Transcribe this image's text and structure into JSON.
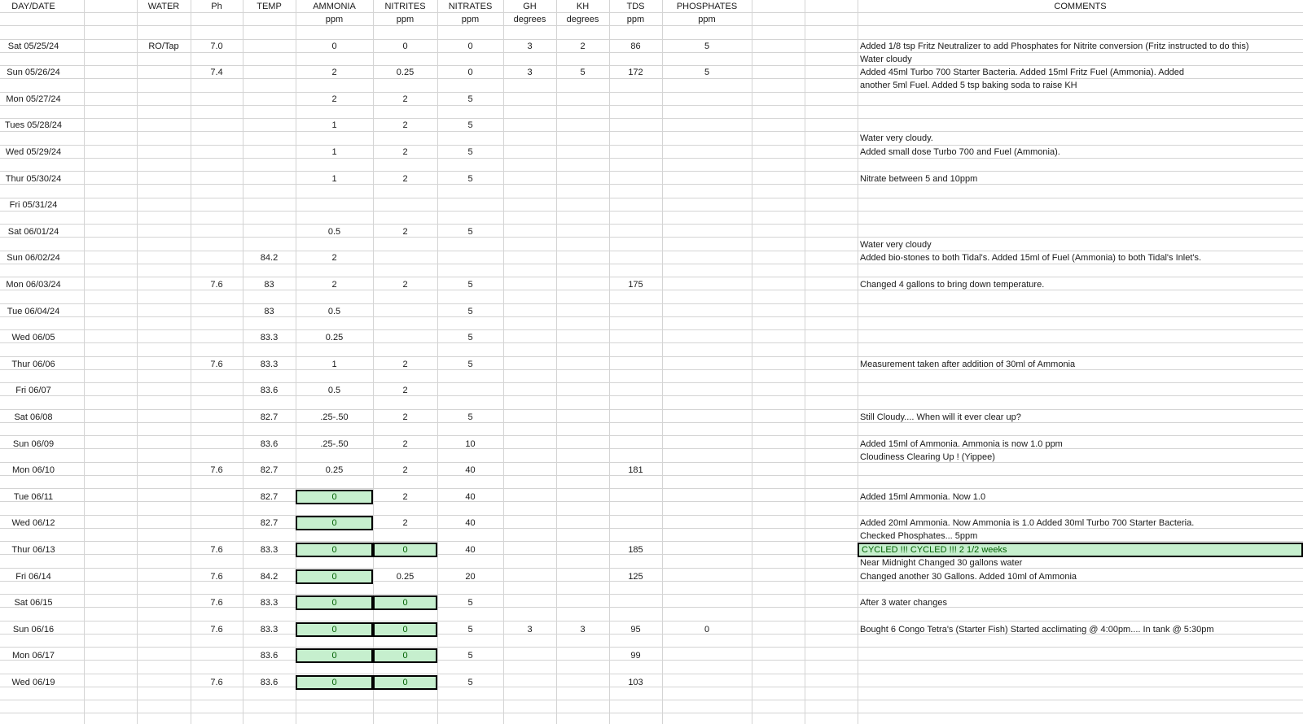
{
  "headers": {
    "date": "DAY/DATE",
    "water": "WATER",
    "ph": "Ph",
    "temp": "TEMP",
    "ammonia": "AMMONIA",
    "nitrites": "NITRITES",
    "nitrates": "NITRATES",
    "gh": "GH",
    "kh": "KH",
    "tds": "TDS",
    "phosphates": "PHOSPHATES",
    "comments": "COMMENTS"
  },
  "units": {
    "ammonia": "ppm",
    "nitrites": "ppm",
    "nitrates": "ppm",
    "gh": "degrees",
    "kh": "degrees",
    "tds": "ppm",
    "phosphates": "ppm"
  },
  "rows": [
    {
      "date": "Sat 05/25/24",
      "water": "RO/Tap",
      "ph": "7.0",
      "temp": "",
      "ammonia": "0",
      "nitrites": "0",
      "nitrates": "0",
      "gh": "3",
      "kh": "2",
      "tds": "86",
      "phosphates": "5",
      "comment": "Added 1/8 tsp Fritz Neutralizer to add Phosphates for Nitrite conversion  (Fritz instructed to do this)",
      "comment2": "Water cloudy"
    },
    {
      "date": "Sun 05/26/24",
      "water": "",
      "ph": "7.4",
      "temp": "",
      "ammonia": "2",
      "nitrites": "0.25",
      "nitrates": "0",
      "gh": "3",
      "kh": "5",
      "tds": "172",
      "phosphates": "5",
      "comment": "Added 45ml Turbo 700 Starter Bacteria. Added 15ml Fritz Fuel (Ammonia). Added",
      "comment2": "another 5ml Fuel. Added 5 tsp baking soda to raise KH"
    },
    {
      "date": "Mon 05/27/24",
      "water": "",
      "ph": "",
      "temp": "",
      "ammonia": "2",
      "nitrites": "2",
      "nitrates": "5",
      "gh": "",
      "kh": "",
      "tds": "",
      "phosphates": "",
      "comment": "",
      "comment2": ""
    },
    {
      "date": "Tues 05/28/24",
      "water": "",
      "ph": "",
      "temp": "",
      "ammonia": "1",
      "nitrites": "2",
      "nitrates": "5",
      "gh": "",
      "kh": "",
      "tds": "",
      "phosphates": "",
      "comment": "",
      "comment2": "Water very cloudy."
    },
    {
      "date": "Wed 05/29/24",
      "water": "",
      "ph": "",
      "temp": "",
      "ammonia": "1",
      "nitrites": "2",
      "nitrates": "5",
      "gh": "",
      "kh": "",
      "tds": "",
      "phosphates": "",
      "comment": "Added small dose Turbo 700 and Fuel (Ammonia).",
      "comment2": ""
    },
    {
      "date": "Thur 05/30/24",
      "water": "",
      "ph": "",
      "temp": "",
      "ammonia": "1",
      "nitrites": "2",
      "nitrates": "5",
      "gh": "",
      "kh": "",
      "tds": "",
      "phosphates": "",
      "comment": "Nitrate between 5 and 10ppm",
      "comment2": ""
    },
    {
      "date": "Fri 05/31/24",
      "water": "",
      "ph": "",
      "temp": "",
      "ammonia": "",
      "nitrites": "",
      "nitrates": "",
      "gh": "",
      "kh": "",
      "tds": "",
      "phosphates": "",
      "comment": "",
      "comment2": ""
    },
    {
      "date": "Sat 06/01/24",
      "water": "",
      "ph": "",
      "temp": "",
      "ammonia": "0.5",
      "nitrites": "2",
      "nitrates": "5",
      "gh": "",
      "kh": "",
      "tds": "",
      "phosphates": "",
      "comment": "",
      "comment2": "Water very cloudy"
    },
    {
      "date": "Sun 06/02/24",
      "water": "",
      "ph": "",
      "temp": "84.2",
      "ammonia": "2",
      "nitrites": "",
      "nitrates": "",
      "gh": "",
      "kh": "",
      "tds": "",
      "phosphates": "",
      "comment": "Added bio-stones to both Tidal's. Added 15ml of Fuel (Ammonia) to both Tidal's Inlet's.",
      "comment2": ""
    },
    {
      "date": "Mon 06/03/24",
      "water": "",
      "ph": "7.6",
      "temp": "83",
      "ammonia": "2",
      "nitrites": "2",
      "nitrates": "5",
      "gh": "",
      "kh": "",
      "tds": "175",
      "phosphates": "",
      "comment": "Changed 4 gallons to bring down temperature.",
      "comment2": ""
    },
    {
      "date": "Tue 06/04/24",
      "water": "",
      "ph": "",
      "temp": "83",
      "ammonia": "0.5",
      "nitrites": "",
      "nitrates": "5",
      "gh": "",
      "kh": "",
      "tds": "",
      "phosphates": "",
      "comment": "",
      "comment2": ""
    },
    {
      "date": "Wed 06/05",
      "water": "",
      "ph": "",
      "temp": "83.3",
      "ammonia": "0.25",
      "nitrites": "",
      "nitrates": "5",
      "gh": "",
      "kh": "",
      "tds": "",
      "phosphates": "",
      "comment": "",
      "comment2": ""
    },
    {
      "date": "Thur 06/06",
      "water": "",
      "ph": "7.6",
      "temp": "83.3",
      "ammonia": "1",
      "nitrites": "2",
      "nitrates": "5",
      "gh": "",
      "kh": "",
      "tds": "",
      "phosphates": "",
      "comment": "Measurement taken after addition of 30ml of Ammonia",
      "comment2": ""
    },
    {
      "date": "Fri 06/07",
      "water": "",
      "ph": "",
      "temp": "83.6",
      "ammonia": "0.5",
      "nitrites": "2",
      "nitrates": "",
      "gh": "",
      "kh": "",
      "tds": "",
      "phosphates": "",
      "comment": "",
      "comment2": ""
    },
    {
      "date": "Sat 06/08",
      "water": "",
      "ph": "",
      "temp": "82.7",
      "ammonia": ".25-.50",
      "nitrites": "2",
      "nitrates": "5",
      "gh": "",
      "kh": "",
      "tds": "",
      "phosphates": "",
      "comment": "Still Cloudy.... When will it ever clear up?",
      "comment2": ""
    },
    {
      "date": "Sun 06/09",
      "water": "",
      "ph": "",
      "temp": "83.6",
      "ammonia": ".25-.50",
      "nitrites": "2",
      "nitrates": "10",
      "gh": "",
      "kh": "",
      "tds": "",
      "phosphates": "",
      "comment": "Added 15ml of Ammonia.  Ammonia is now 1.0 ppm",
      "comment2": "Cloudiness Clearing Up ! (Yippee)"
    },
    {
      "date": "Mon 06/10",
      "water": "",
      "ph": "7.6",
      "temp": "82.7",
      "ammonia": "0.25",
      "nitrites": "2",
      "nitrates": "40",
      "gh": "",
      "kh": "",
      "tds": "181",
      "phosphates": "",
      "comment": "",
      "comment2": ""
    },
    {
      "date": "Tue 06/11",
      "water": "",
      "ph": "",
      "temp": "82.7",
      "ammonia": "0",
      "nitrites": "2",
      "nitrates": "40",
      "gh": "",
      "kh": "",
      "tds": "",
      "phosphates": "",
      "comment": "Added 15ml Ammonia. Now 1.0",
      "comment2": ""
    },
    {
      "date": "Wed 06/12",
      "water": "",
      "ph": "",
      "temp": "82.7",
      "ammonia": "0",
      "nitrites": "2",
      "nitrates": "40",
      "gh": "",
      "kh": "",
      "tds": "",
      "phosphates": "",
      "comment": "Added 20ml Ammonia. Now Ammonia is 1.0  Added 30ml Turbo 700 Starter Bacteria.",
      "comment2": "Checked Phosphates... 5ppm"
    },
    {
      "date": "Thur 06/13",
      "water": "",
      "ph": "7.6",
      "temp": "83.3",
      "ammonia": "0",
      "nitrites": "0",
      "nitrates": "40",
      "gh": "",
      "kh": "",
      "tds": "185",
      "phosphates": "",
      "comment": "CYCLED !!! CYCLED !!!   2 1/2 weeks",
      "comment2": "Near Midnight Changed 30 gallons water"
    },
    {
      "date": "Fri 06/14",
      "water": "",
      "ph": "7.6",
      "temp": "84.2",
      "ammonia": "0",
      "nitrites": "0.25",
      "nitrates": "20",
      "gh": "",
      "kh": "",
      "tds": "125",
      "phosphates": "",
      "comment": "Changed another 30 Gallons. Added 10ml of Ammonia",
      "comment2": ""
    },
    {
      "date": "Sat 06/15",
      "water": "",
      "ph": "7.6",
      "temp": "83.3",
      "ammonia": "0",
      "nitrites": "0",
      "nitrates": "5",
      "gh": "",
      "kh": "",
      "tds": "",
      "phosphates": "",
      "comment": "After 3 water changes",
      "comment2": ""
    },
    {
      "date": "Sun 06/16",
      "water": "",
      "ph": "7.6",
      "temp": "83.3",
      "ammonia": "0",
      "nitrites": "0",
      "nitrates": "5",
      "gh": "3",
      "kh": "3",
      "tds": "95",
      "phosphates": "0",
      "comment": "Bought 6 Congo Tetra's (Starter Fish) Started acclimating @ 4:00pm....  In tank @ 5:30pm",
      "comment2": ""
    },
    {
      "date": "Mon 06/17",
      "water": "",
      "ph": "",
      "temp": "83.6",
      "ammonia": "0",
      "nitrites": "0",
      "nitrates": "5",
      "gh": "",
      "kh": "",
      "tds": "99",
      "phosphates": "",
      "comment": "",
      "comment2": ""
    },
    {
      "date": "Wed 06/19",
      "water": "",
      "ph": "7.6",
      "temp": "83.6",
      "ammonia": "0",
      "nitrites": "0",
      "nitrates": "5",
      "gh": "",
      "kh": "",
      "tds": "103",
      "phosphates": "",
      "comment": "",
      "comment2": ""
    }
  ],
  "highlight_color": "#c6efce",
  "highlight_text_color": "#006100"
}
